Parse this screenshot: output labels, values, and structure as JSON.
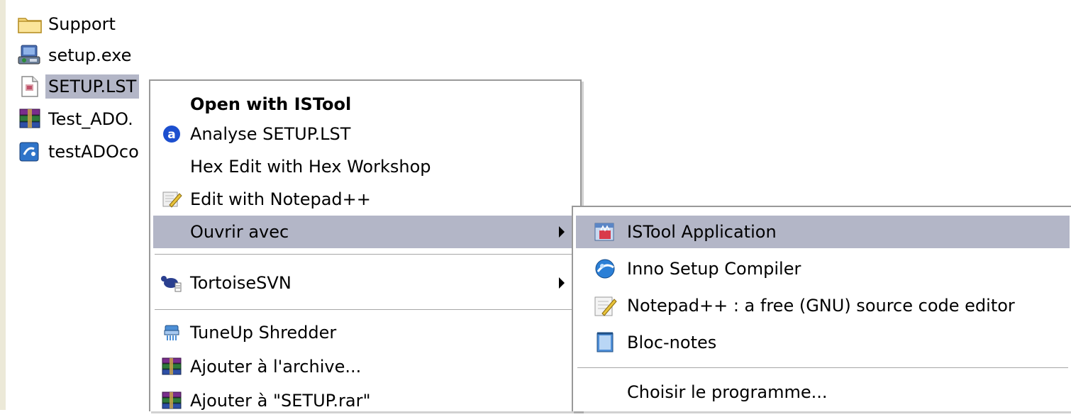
{
  "files": [
    {
      "name": "Support",
      "icon": "folder-icon"
    },
    {
      "name": "setup.exe",
      "icon": "setup-exe-icon"
    },
    {
      "name": "SETUP.LST",
      "icon": "lst-file-icon"
    },
    {
      "name": "Test_ADO.",
      "icon": "winrar-archive-icon"
    },
    {
      "name": "testADOco",
      "icon": "script-file-icon"
    }
  ],
  "context_menu": {
    "open_istool": "Open with ISTool",
    "analyse": "Analyse SETUP.LST",
    "hex_edit": "Hex Edit with Hex Workshop",
    "edit_notepadpp": "Edit with Notepad++",
    "open_with": "Ouvrir avec",
    "tortoise": "TortoiseSVN",
    "shredder": "TuneUp Shredder",
    "add_archive": "Ajouter à l'archive...",
    "add_setup_rar": "Ajouter à \"SETUP.rar\""
  },
  "submenu": {
    "istool": "ISTool Application",
    "inno": "Inno Setup Compiler",
    "notepadpp": "Notepad++ : a free (GNU) source code editor",
    "bloc_notes": "Bloc-notes",
    "choose": "Choisir le programme..."
  },
  "colors": {
    "highlight": "#b3b6c7",
    "menu_border": "#999999",
    "explorer_edge": "#ece9d8"
  }
}
